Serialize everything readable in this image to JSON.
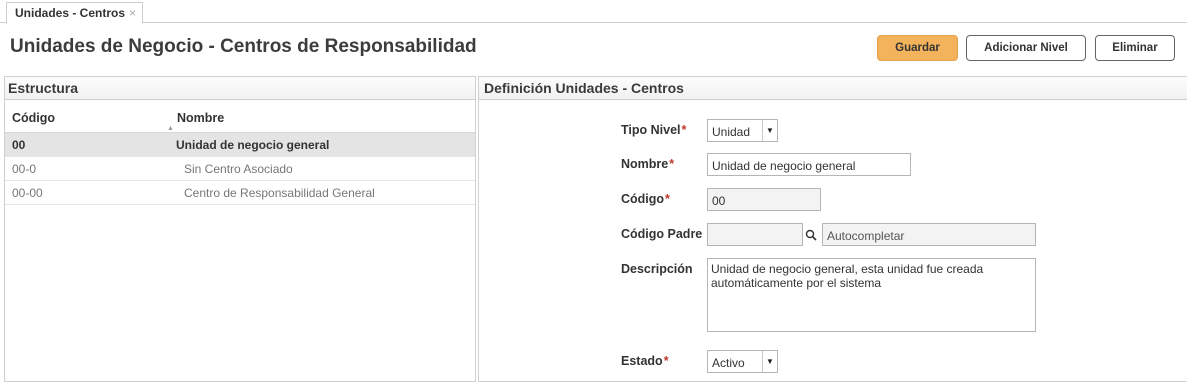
{
  "tab": {
    "label": "Unidades - Centros",
    "close": "×"
  },
  "page": {
    "title": "Unidades de Negocio - Centros de Responsabilidad"
  },
  "toolbar": {
    "save_label": "Guardar",
    "add_level_label": "Adicionar Nivel",
    "delete_label": "Eliminar",
    "accent": "#f2b35c"
  },
  "structure": {
    "title": "Estructura",
    "columns": {
      "code": "Código",
      "name": "Nombre"
    },
    "rows": [
      {
        "code": "00",
        "name": "Unidad de negocio general",
        "selected": true
      },
      {
        "code": "00-0",
        "name": "Sin Centro Asociado",
        "selected": false
      },
      {
        "code": "00-00",
        "name": "Centro de Responsabilidad General",
        "selected": false
      }
    ]
  },
  "definition": {
    "title": "Definición Unidades - Centros",
    "required_mark": "*",
    "tipo_nivel": {
      "label": "Tipo Nivel",
      "value": "Unidad"
    },
    "nombre": {
      "label": "Nombre",
      "value": "Unidad de negocio general"
    },
    "codigo": {
      "label": "Código",
      "value": "00"
    },
    "codigo_padre": {
      "label": "Código Padre",
      "value": "",
      "autocomplete_placeholder": "Autocompletar"
    },
    "descripcion": {
      "label": "Descripción",
      "value": "Unidad de negocio general, esta unidad fue creada automáticamente por el sistema"
    },
    "estado": {
      "label": "Estado",
      "value": "Activo"
    }
  }
}
